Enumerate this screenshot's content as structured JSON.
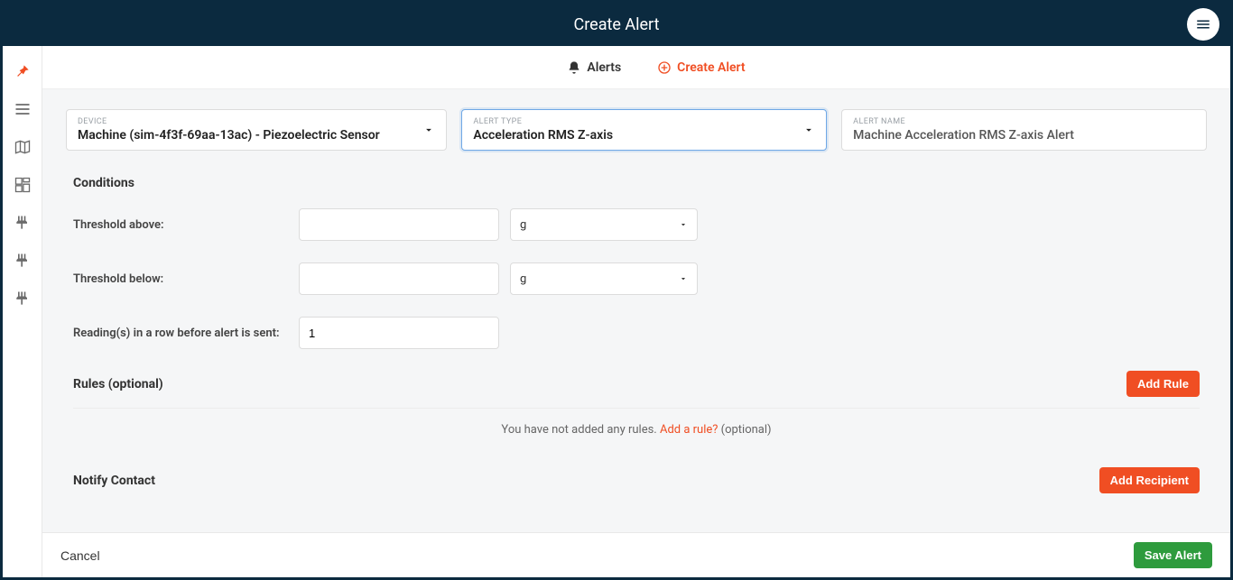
{
  "header": {
    "title": "Create Alert"
  },
  "subnav": {
    "alerts_label": "Alerts",
    "create_alert_label": "Create Alert"
  },
  "device_field": {
    "micro": "DEVICE",
    "value": "Machine (sim-4f3f-69aa-13ac) - Piezoelectric Sensor"
  },
  "alert_type_field": {
    "micro": "ALERT TYPE",
    "value": "Acceleration RMS Z-axis"
  },
  "alert_name_field": {
    "micro": "ALERT NAME",
    "value": "Machine Acceleration RMS Z-axis Alert"
  },
  "sections": {
    "conditions": "Conditions",
    "rules": "Rules (optional)",
    "notify": "Notify Contact"
  },
  "conditions": {
    "threshold_above_label": "Threshold above:",
    "threshold_below_label": "Threshold below:",
    "readings_label": "Reading(s) in a row before alert is sent:",
    "unit_value": "g",
    "readings_value": "1"
  },
  "rules_empty": {
    "prefix": "You have not added any rules.  ",
    "link": "Add a rule?",
    "suffix": " (optional)"
  },
  "buttons": {
    "add_rule": "Add Rule",
    "add_recipient": "Add Recipient",
    "cancel": "Cancel",
    "save_alert": "Save Alert"
  }
}
